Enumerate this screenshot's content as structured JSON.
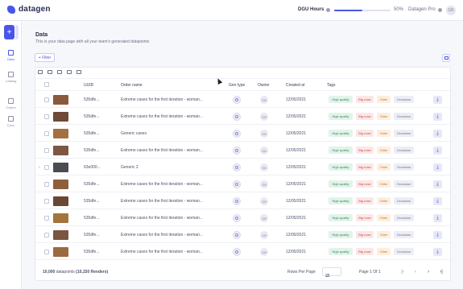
{
  "brand": {
    "name": "datagen"
  },
  "topbar": {
    "dgu_label": "DGU Hours",
    "progress": 0.5,
    "progress_text": "50%",
    "plan": "Datagen Pro",
    "avatar": "GB"
  },
  "sidebar": {
    "add_label": "+",
    "items": [
      {
        "label": "Data",
        "icon": "data-icon",
        "active": true
      },
      {
        "label": "Catalog",
        "icon": "catalog-icon",
        "active": false
      },
      {
        "label": "Orders",
        "icon": "orders-icon",
        "active": false
      },
      {
        "label": "Docs",
        "icon": "docs-icon",
        "active": false
      }
    ]
  },
  "page": {
    "title": "Data",
    "subtitle": "This is your data page with all your team's generated datapoints",
    "filter_label": "+ Filter"
  },
  "table": {
    "headers": {
      "uuid": "UUID",
      "order_name": "Order name",
      "gen_type": "Gen type",
      "owner": "Owner",
      "created_at": "Created at",
      "tags": "Tags"
    },
    "tags": {
      "hq": "High quality",
      "bn": "Big nose",
      "old": "Older",
      "occ": "Occlusion"
    },
    "rows": [
      {
        "uuid": "535dfe...",
        "order": "Extreme cases for the first iteration - woman...",
        "owner": "GB",
        "created": "12/05/2021",
        "thumb": "#8a5a3c"
      },
      {
        "uuid": "535dfe...",
        "order": "Extreme cases for the first iteration - woman...",
        "owner": "GB",
        "created": "12/05/2021",
        "thumb": "#6f4a36"
      },
      {
        "uuid": "535dfe...",
        "order": "Generic cases",
        "owner": "GB",
        "created": "12/05/2021",
        "thumb": "#a5703f"
      },
      {
        "uuid": "535dfe...",
        "order": "Extreme cases for the first iteration - woman...",
        "owner": "GB",
        "created": "12/05/2021",
        "thumb": "#7d5742"
      },
      {
        "uuid": "63e000...",
        "order": "Generic 2",
        "owner": "GB",
        "created": "12/05/2021",
        "thumb": "#4b4b52"
      },
      {
        "uuid": "535dfe...",
        "order": "Extreme cases for the first iteration - woman...",
        "owner": "GB",
        "created": "12/05/2021",
        "thumb": "#8e5f3a"
      },
      {
        "uuid": "535dfe...",
        "order": "Extreme cases for the first iteration - woman...",
        "owner": "GB",
        "created": "12/05/2021",
        "thumb": "#6a4634"
      },
      {
        "uuid": "535dfe...",
        "order": "Extreme cases for the first iteration - woman...",
        "owner": "GB",
        "created": "12/05/2021",
        "thumb": "#a4743b"
      },
      {
        "uuid": "535dfe...",
        "order": "Extreme cases for the first iteration - woman...",
        "owner": "GB",
        "created": "12/05/2021",
        "thumb": "#7a5540"
      },
      {
        "uuid": "535dfe...",
        "order": "Extreme cases for the first iteration - woman...",
        "owner": "GB",
        "created": "12/05/2021",
        "thumb": "#9c6a40"
      }
    ]
  },
  "footer": {
    "datapoints": "10,000",
    "datapoints_label": "datapoints",
    "renders": "(10,150 Renders)",
    "rows_per_page_label": "Rows Per Page",
    "rows_per_page": "25",
    "page_label": "Page",
    "page": "1",
    "of_label": "Of",
    "total_pages": "1"
  }
}
